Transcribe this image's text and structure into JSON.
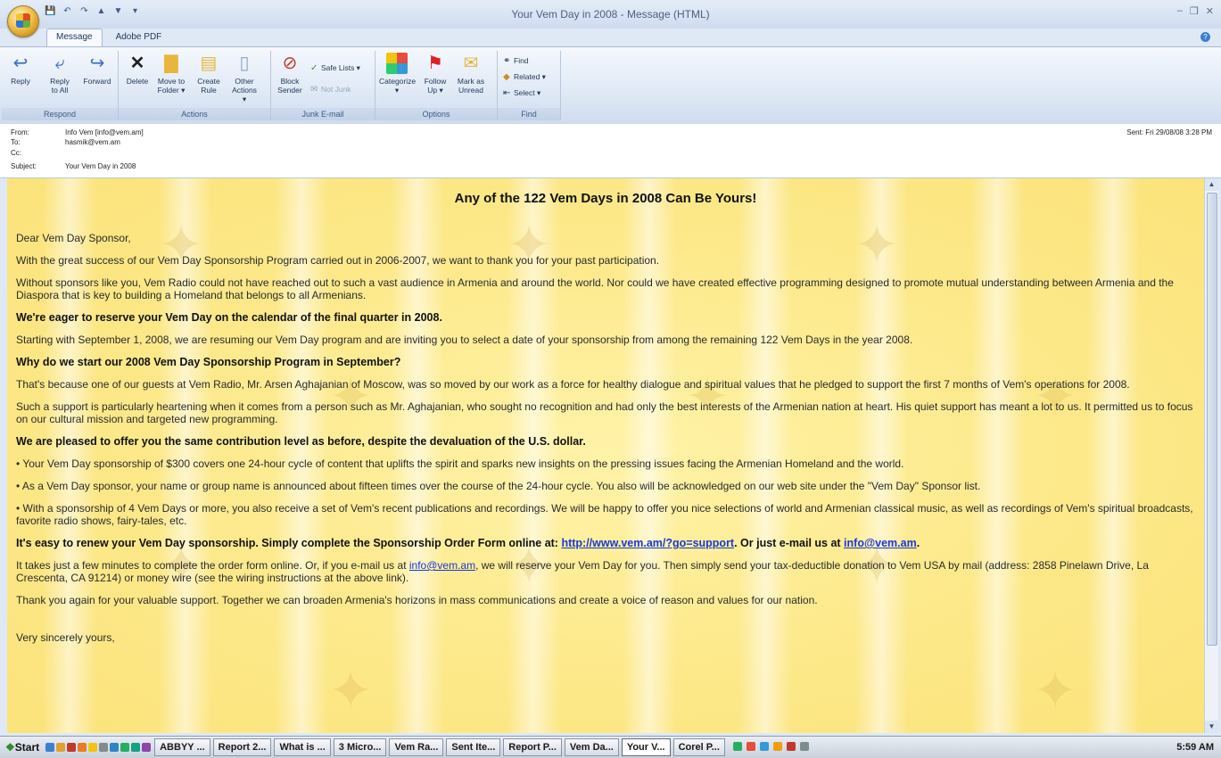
{
  "window": {
    "title": "Your Vem Day in 2008 - Message (HTML)"
  },
  "tabs": [
    {
      "label": "Message"
    },
    {
      "label": "Adobe PDF"
    }
  ],
  "ribbon": {
    "respond": {
      "label": "Respond",
      "reply": "Reply",
      "reply_all": "Reply\nto All",
      "forward": "Forward"
    },
    "actions": {
      "label": "Actions",
      "delete": "Delete",
      "move": "Move to\nFolder ▾",
      "create_rule": "Create\nRule",
      "other": "Other\nActions ▾"
    },
    "junk": {
      "label": "Junk E-mail",
      "block": "Block\nSender",
      "safe_lists": "Safe Lists ▾",
      "not_junk": "Not Junk"
    },
    "options": {
      "label": "Options",
      "categorize": "Categorize\n▾",
      "follow_up": "Follow\nUp ▾",
      "mark_unread": "Mark as\nUnread"
    },
    "find": {
      "label": "Find",
      "find": "Find",
      "related": "Related ▾",
      "select": "Select ▾"
    }
  },
  "header": {
    "from_label": "From:",
    "from": "Info Vem [info@vem.am]",
    "to_label": "To:",
    "to": "hasmik@vem.am",
    "cc_label": "Cc:",
    "cc": "",
    "subject_label": "Subject:",
    "subject": "Your Vem Day in 2008",
    "sent_label": "Sent:",
    "sent": "Fri 29/08/08 3:28 PM"
  },
  "body": {
    "headline": "Any of the 122 Vem Days in 2008 Can Be Yours!",
    "greeting": "Dear Vem Day Sponsor,",
    "p1": "With the great success of our Vem Day Sponsorship Program carried out in 2006-2007, we want to thank you for your past participation.",
    "p2": "Without sponsors like you, Vem Radio could not have reached out to such a vast audience in Armenia and around the world. Nor could we have created effective programming designed to promote mutual understanding between Armenia and the Diaspora that is key to building a Homeland that belongs to all Armenians.",
    "h1": "We're eager to reserve your Vem Day on the calendar of the final quarter in 2008.",
    "p3": "Starting with September 1, 2008, we are resuming our Vem Day program and are inviting you to select a date of your sponsorship from among the remaining 122 Vem Days in the year 2008.",
    "h2": "Why do we start our 2008 Vem Day Sponsorship Program in September?",
    "p4": "That's because one of our guests at Vem Radio, Mr. Arsen Aghajanian of Moscow, was so moved by our work as a force for healthy dialogue and spiritual values that he pledged to support the first 7 months of Vem's operations for 2008.",
    "p5": "Such a support is particularly heartening when it comes from a person such as Mr. Aghajanian, who sought no recognition and had only the best interests of the Armenian nation at heart. His quiet support has meant a lot to us. It permitted us to focus on our cultural mission and targeted new programming.",
    "h3": "We are pleased to offer you the same contribution level as before, despite the devaluation of the U.S. dollar.",
    "b1": "• Your Vem Day sponsorship of $300 covers one 24-hour cycle of content that uplifts the spirit and sparks new insights on the pressing issues facing the Armenian Homeland and the world.",
    "b2": "• As a Vem Day sponsor, your name or group name is announced about fifteen times over the course of the 24-hour cycle. You also will be acknowledged on our web site under the \"Vem Day\" Sponsor list.",
    "b3": "• With a sponsorship of 4 Vem Days or more, you also receive a set of Vem's recent publications and recordings. We will be happy to offer you nice selections of world and Armenian classical music, as well as recordings of Vem's spiritual broadcasts, favorite radio shows, fairy-tales, etc.",
    "h4_pre": "It's easy to renew your Vem Day sponsorship. Simply complete the Sponsorship Order Form online at: ",
    "h4_link": "http://www.vem.am/?go=support",
    "h4_mid": ". Or just e-mail us at ",
    "h4_email": "info@vem.am",
    "h4_post": ".",
    "p6_pre": "It takes just a few minutes to complete the order form online. Or, if you e-mail us at ",
    "p6_email": "info@vem.am",
    "p6_post": ", we will reserve your Vem Day for you. Then simply send your tax-deductible donation to Vem USA by mail (address: 2858 Pinelawn Drive, La Crescenta, CA 91214) or money wire (see the wiring instructions at the above link).",
    "p7": "Thank you again for your valuable support. Together we can broaden Armenia's horizons in mass communications and create a voice of reason and values for our nation.",
    "closing": "Very sincerely yours,"
  },
  "taskbar": {
    "start": "Start",
    "items": [
      "ABBYY ...",
      "Report 2...",
      "What is ...",
      "3 Micro...",
      "Vem Ra...",
      "Sent Ite...",
      "Report P...",
      "Vem Da...",
      "Your V...",
      "Corel P..."
    ],
    "clock": "5:59 AM"
  }
}
